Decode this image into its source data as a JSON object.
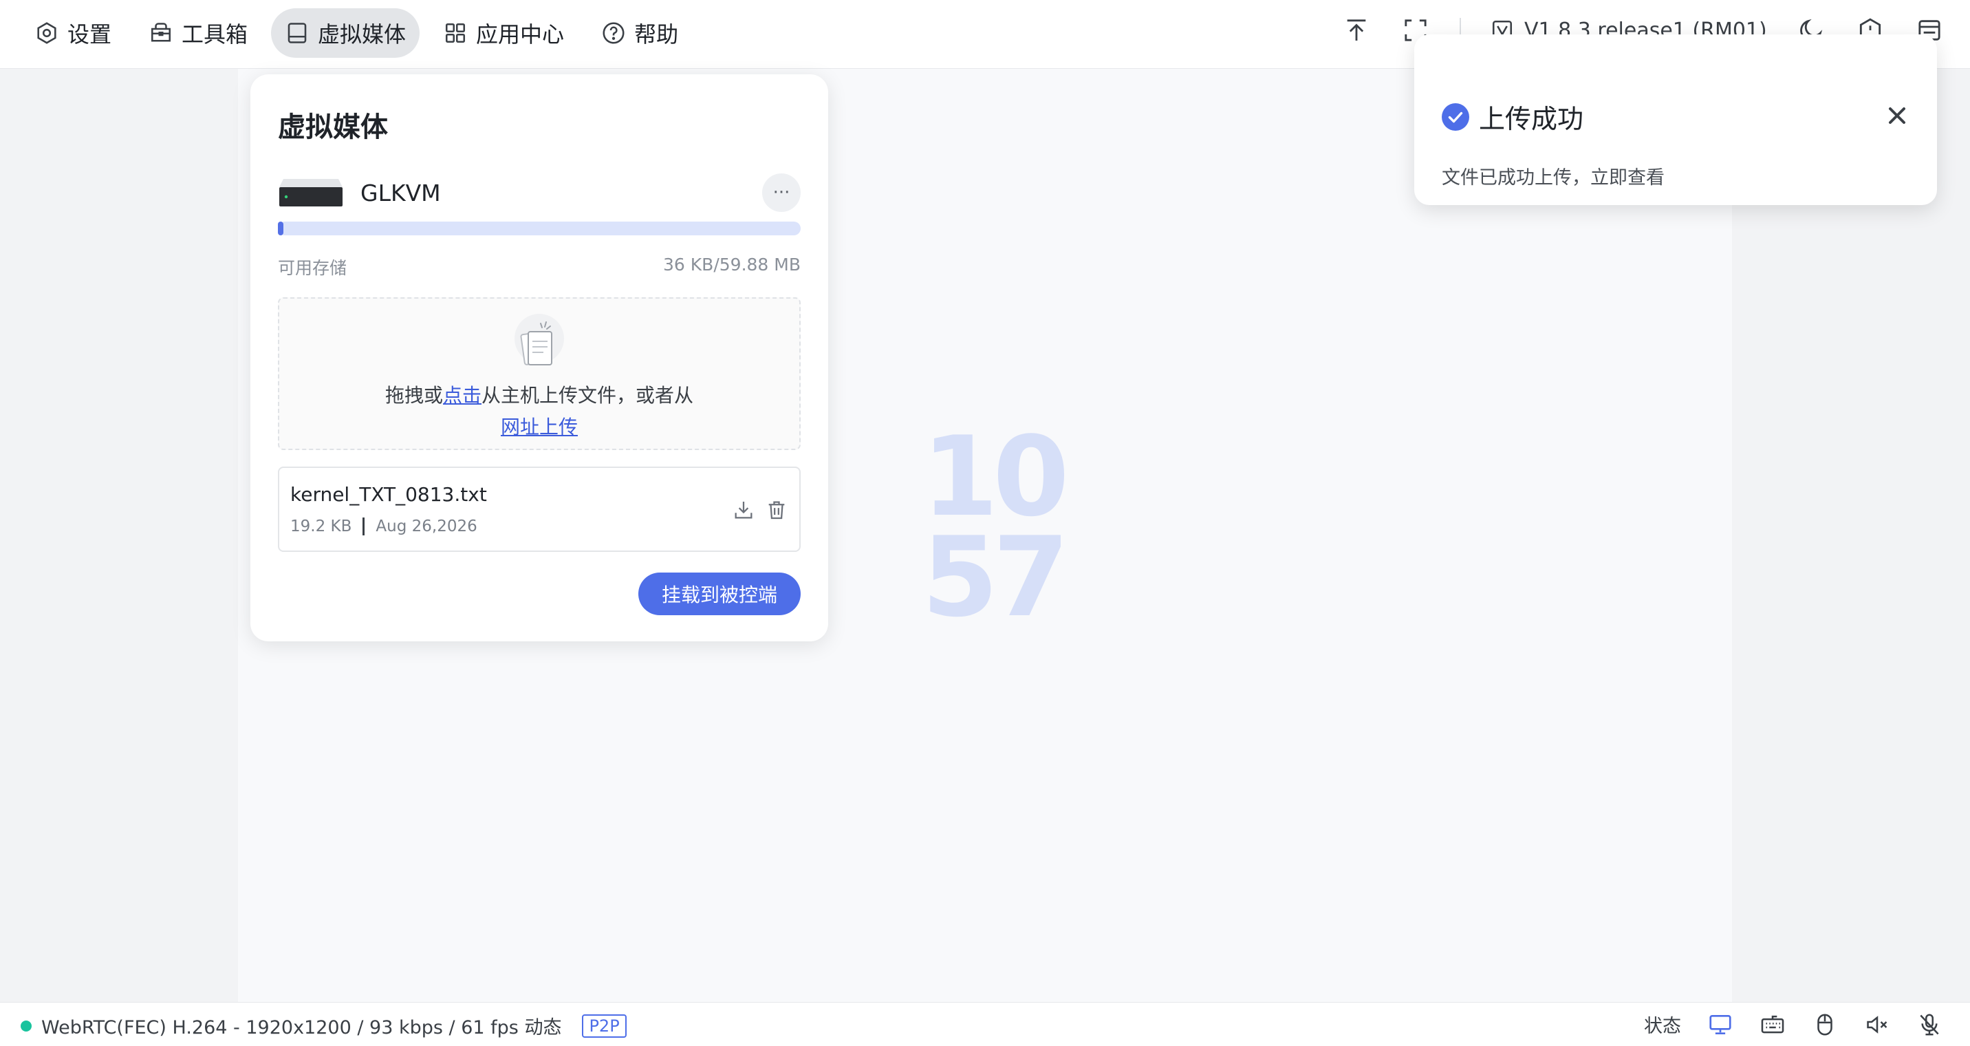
{
  "nav": {
    "items": [
      {
        "label": "设置",
        "icon": "settings-icon",
        "active": false
      },
      {
        "label": "工具箱",
        "icon": "toolbox-icon",
        "active": false
      },
      {
        "label": "虚拟媒体",
        "icon": "drive-icon",
        "active": true
      },
      {
        "label": "应用中心",
        "icon": "apps-grid-icon",
        "active": false
      },
      {
        "label": "帮助",
        "icon": "help-icon",
        "active": false
      }
    ]
  },
  "topbar": {
    "version_text": "V1.8.3 release1 (RM01)",
    "icons": [
      "upload-top-icon",
      "fullscreen-icon",
      "theme-icon",
      "shield-icon",
      "panel-icon",
      "logout-icon"
    ]
  },
  "clock": {
    "hours": "10",
    "minutes": "57"
  },
  "virtual_media": {
    "title": "虚拟媒体",
    "drive_name": "GLKVM",
    "more_label": "···",
    "storage_label": "可用存储",
    "storage_value": "36 KB/59.88 MB",
    "storage_used_percent": 1,
    "dropzone": {
      "text_before": "拖拽或",
      "link_click": "点击",
      "text_after": "从主机上传文件，或者从",
      "link_url": "网址上传"
    },
    "file": {
      "name": "kernel_TXT_0813.txt",
      "size": "19.2 KB",
      "date": "Aug 26,2026"
    },
    "mount_button": "挂载到被控端"
  },
  "toast": {
    "title": "上传成功",
    "body": "文件已成功上传，立即查看"
  },
  "statusbar": {
    "stream_info": "WebRTC(FEC) H.264 - 1920x1200 /  93 kbps / 61 fps 动态",
    "p2p_badge": "P2P",
    "status_label": "状态",
    "colors": {
      "ok": "#19c39d",
      "accent": "#4e6ee8"
    }
  }
}
